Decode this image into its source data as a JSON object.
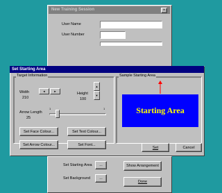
{
  "background_window": {
    "title": "New Training Session",
    "close_glyph": "×",
    "user_name_label": "User Name",
    "user_number_label": "User Number",
    "set_starting_area_label": "Set Starting Area",
    "set_background_label": "Set Background",
    "ellipsis": "...",
    "show_arrangement_label": "Show Arrangement",
    "done_label": "Done"
  },
  "dialog": {
    "title": "Set Starting Area",
    "target_info": {
      "group_title": "Target Information",
      "width_label": "Width",
      "width_value": "210",
      "height_label": "Height",
      "height_value": "100",
      "arrow_length_label": "Arrow Length",
      "arrow_length_value": "25",
      "slider_min": "1",
      "slider_max": "1",
      "slider_level": 0.12,
      "left_arrow": "◄",
      "right_arrow": "►",
      "up_arrow": "▲",
      "down_arrow": "▼"
    },
    "buttons": {
      "set_face_colour": "Set Face Colour...",
      "set_text_colour": "Set Text Colour...",
      "set_arrow_colour": "Set Arrow Colour...",
      "set_font": "Set Font...",
      "set": "Set",
      "cancel": "Cancel"
    },
    "sample": {
      "group_title": "Sample Starting Area",
      "area_text": "Starting Area",
      "face_colour": "#0000ff",
      "text_colour": "#ffff00",
      "arrow_colour": "#ff0000"
    }
  }
}
